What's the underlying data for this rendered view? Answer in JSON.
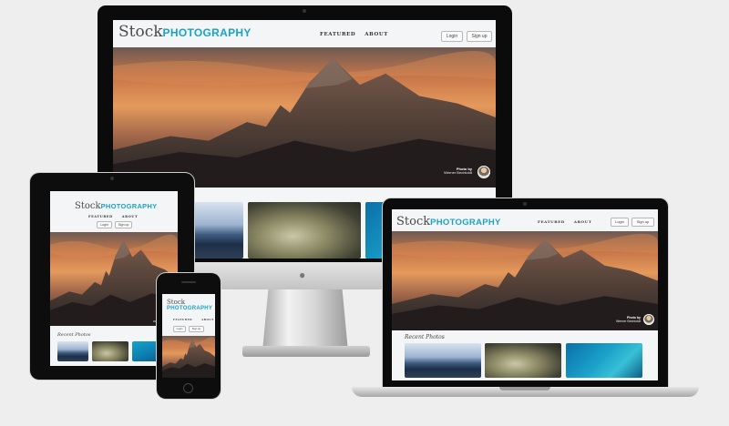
{
  "site": {
    "brand_word1": "Stock",
    "brand_word2": "PHOTOGRAPHY",
    "nav": [
      "FEATURED",
      "ABOUT"
    ],
    "login_label": "Login",
    "signup_label": "Sign up",
    "photo_by_label": "Photo by",
    "photographer": "Werner Bechtoldt",
    "recent_photos_label": "Recent Photos"
  },
  "colors": {
    "brand_accent": "#1aa3c8",
    "page_background": "#eeeeee",
    "device_bezel": "#0b0b0b"
  },
  "icons": {
    "apple_logo": "apple-logo-icon",
    "camera": "camera-icon",
    "home_button": "home-button-icon"
  }
}
